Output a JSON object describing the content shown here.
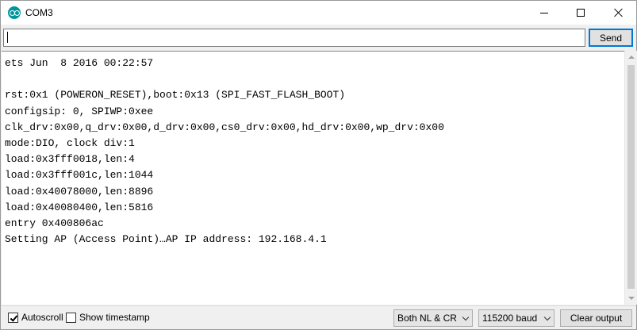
{
  "window": {
    "title": "COM3",
    "icon": "arduino-icon"
  },
  "input": {
    "value": "",
    "send_label": "Send"
  },
  "output": {
    "lines": [
      "ets Jun  8 2016 00:22:57",
      "",
      "rst:0x1 (POWERON_RESET),boot:0x13 (SPI_FAST_FLASH_BOOT)",
      "configsip: 0, SPIWP:0xee",
      "clk_drv:0x00,q_drv:0x00,d_drv:0x00,cs0_drv:0x00,hd_drv:0x00,wp_drv:0x00",
      "mode:DIO, clock div:1",
      "load:0x3fff0018,len:4",
      "load:0x3fff001c,len:1044",
      "load:0x40078000,len:8896",
      "load:0x40080400,len:5816",
      "entry 0x400806ac",
      "Setting AP (Access Point)…AP IP address: 192.168.4.1"
    ]
  },
  "bottom": {
    "autoscroll_label": "Autoscroll",
    "autoscroll_checked": true,
    "timestamp_label": "Show timestamp",
    "timestamp_checked": false,
    "line_ending": "Both NL & CR",
    "baud": "115200 baud",
    "clear_label": "Clear output"
  },
  "colors": {
    "accent": "#0078d7",
    "icon": "#00979c"
  }
}
